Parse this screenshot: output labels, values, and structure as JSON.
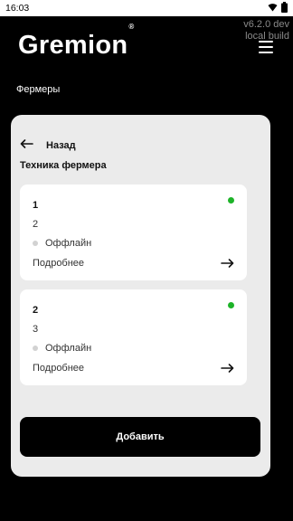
{
  "status_bar": {
    "time": "16:03",
    "icons": [
      "wifi-icon",
      "battery-icon"
    ]
  },
  "build": {
    "version": "v6.2.0 dev",
    "type": "local build"
  },
  "header": {
    "logo": "Gremion",
    "trademark": "®",
    "menu_icon": "hamburger-menu-icon"
  },
  "breadcrumb": "Фермеры",
  "panel": {
    "back_label": "Назад",
    "title": "Техника фермера",
    "cards": [
      {
        "name": "1",
        "value": "2",
        "status": "Оффлайн",
        "details_label": "Подробнее",
        "indicator_color": "#1db328"
      },
      {
        "name": "2",
        "value": "3",
        "status": "Оффлайн",
        "details_label": "Подробнее",
        "indicator_color": "#1db328"
      }
    ],
    "add_label": "Добавить"
  },
  "colors": {
    "background": "#000000",
    "panel": "#ebebeb",
    "card": "#ffffff",
    "offline_dot": "#d2d2d2"
  }
}
